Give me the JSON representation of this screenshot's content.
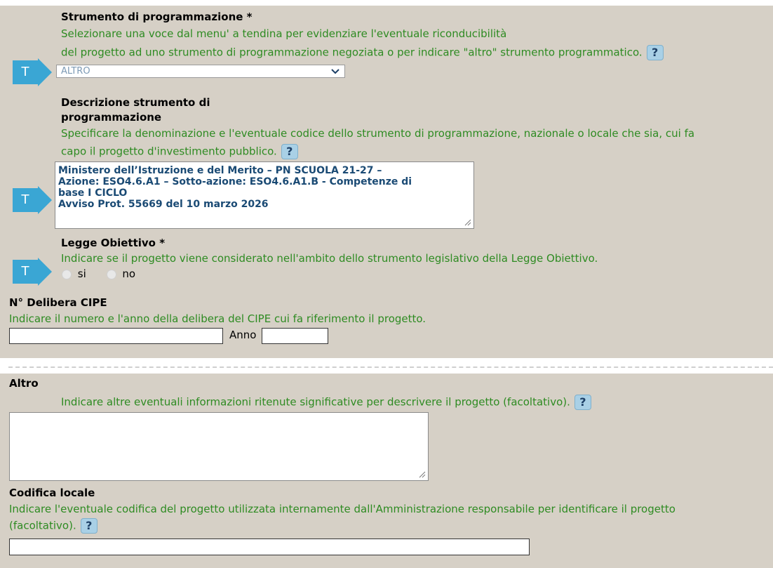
{
  "strumento": {
    "title": "Strumento di programmazione *",
    "desc_line1": "Selezionare una voce dal menu' a tendina per evidenziare l'eventuale riconducibilità",
    "desc_line2": "del progetto ad uno strumento di programmazione negoziata o per indicare \"altro\" strumento programmatico.",
    "help_label": "?",
    "select_value": "ALTRO"
  },
  "descrizione": {
    "title_line1": "Descrizione strumento di",
    "title_line2": "programmazione",
    "desc_line1": "Specificare la denominazione e l'eventuale codice dello strumento di programmazione, nazionale o locale che sia, cui fa",
    "desc_line2": "capo il progetto d'investimento pubblico.",
    "help_label": "?",
    "value_lines": [
      "Ministero dell’Istruzione e del Merito – PN SCUOLA  21-27 –",
      "Azione: ESO4.6.A1 – Sotto-azione: ESO4.6.A1.B - Competenze di",
      "base I CICLO",
      "Avviso Prot. 55669 del 10 marzo 2026"
    ]
  },
  "legge": {
    "title": "Legge Obiettivo *",
    "desc": "Indicare se il progetto viene considerato nell'ambito dello strumento legislativo della Legge Obiettivo.",
    "option_si": "si",
    "option_no": "no"
  },
  "delibera": {
    "title": "N° Delibera CIPE",
    "desc": "Indicare il numero e l'anno della delibera del CIPE cui fa riferimento il progetto.",
    "anno_label": "Anno"
  },
  "altro": {
    "title": "Altro",
    "desc": "Indicare altre eventuali informazioni ritenute significative per descrivere il progetto (facoltativo).",
    "help_label": "?"
  },
  "codifica": {
    "title": "Codifica locale",
    "desc_line1": "Indicare l'eventuale codifica del progetto utilizzata internamente dall'Amministrazione responsabile per identificare il progetto",
    "desc_line2": "(facoltativo).",
    "help_label": "?"
  },
  "marker_label": "T",
  "colors": {
    "background": "#d6d0c6",
    "green_text": "#2e8b22",
    "marker_blue": "#3aa6d4"
  }
}
